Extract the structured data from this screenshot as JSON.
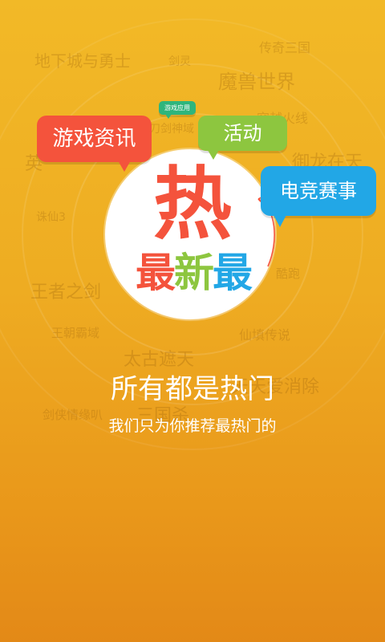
{
  "background_words": [
    "地下城与勇士",
    "剑灵",
    "传奇三国",
    "魔兽世界",
    "穿越火线",
    "刀剑神域",
    "御龙在天",
    "英",
    "诛仙3",
    "王者之剑",
    "酷跑",
    "王朝霸域",
    "仙填传说",
    "太古遮天",
    "天天爱消除",
    "剑侠情缘叭",
    "三国杀"
  ],
  "bubbles": {
    "news": "游戏资讯",
    "activity": "活动",
    "esports": "电竞赛事",
    "game_app": "游戏应用"
  },
  "logo": {
    "hot": "热",
    "newest": [
      "最",
      "新",
      "最"
    ]
  },
  "headline": "所有都是热门",
  "subline": "我们只为你推荐最热门的",
  "colors": {
    "background_top": "#f2b927",
    "background_bottom": "#e38917",
    "red": "#f4533c",
    "green": "#8dc63f",
    "blue": "#22a7e6",
    "teal": "#2fb57c",
    "newest_colors": [
      "#f4533c",
      "#8dc63f",
      "#22a7e6"
    ]
  }
}
